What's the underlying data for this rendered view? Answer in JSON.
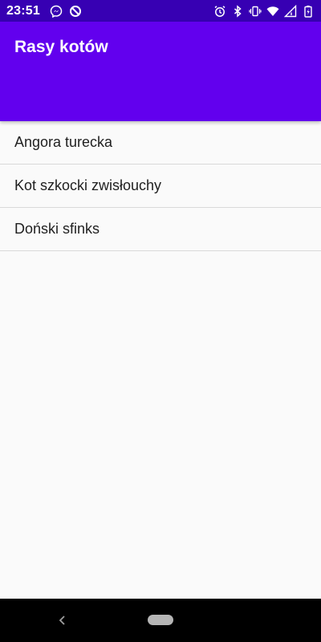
{
  "status_bar": {
    "time": "23:51",
    "left_icons": [
      "messenger-icon",
      "data-saver-icon"
    ],
    "right_icons": [
      "alarm-icon",
      "bluetooth-icon",
      "vibrate-icon",
      "wifi-icon",
      "signal-icon",
      "battery-icon"
    ]
  },
  "app_bar": {
    "title": "Rasy kotów"
  },
  "list": {
    "items": [
      {
        "label": "Angora turecka"
      },
      {
        "label": "Kot szkocki zwisłouchy"
      },
      {
        "label": "Doński sfinks"
      }
    ]
  },
  "nav_bar": {
    "buttons": [
      "back-icon",
      "home-pill-icon"
    ]
  },
  "colors": {
    "status_bar": "#3700b3",
    "app_bar": "#6200ee",
    "background": "#fafafa",
    "text": "#212121",
    "divider": "#d9d9d9"
  }
}
